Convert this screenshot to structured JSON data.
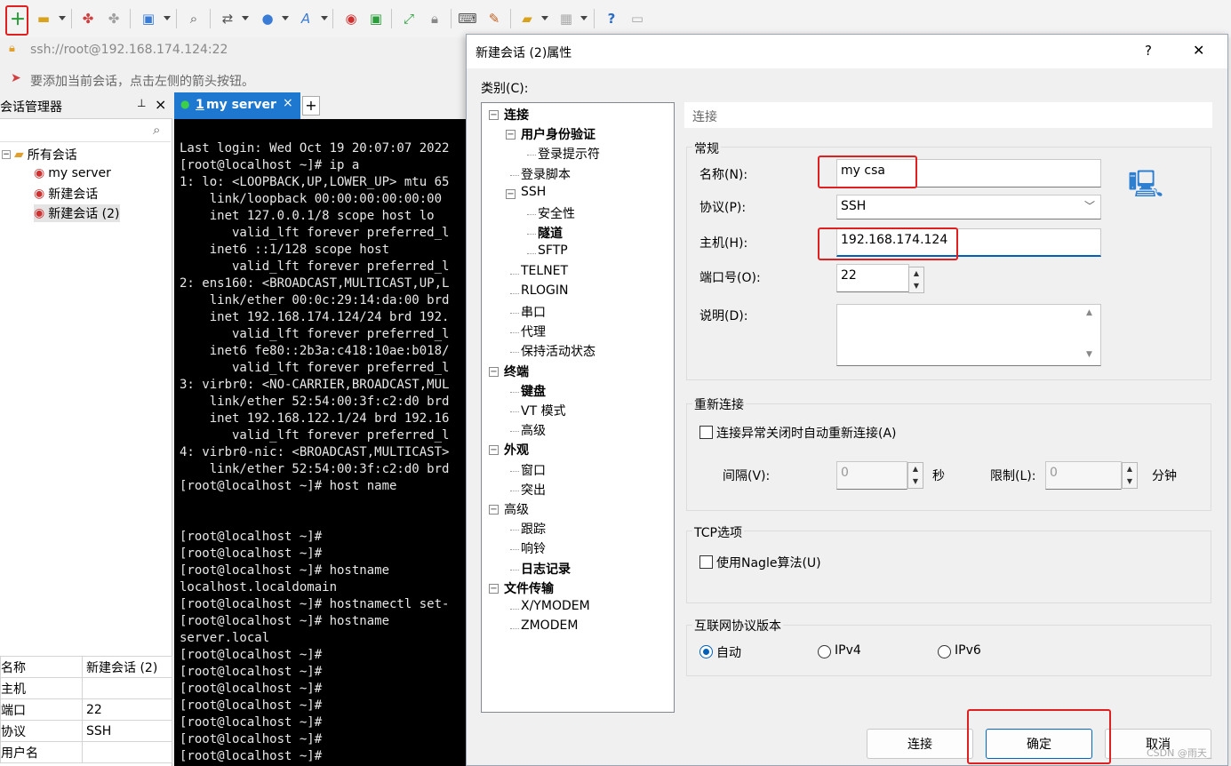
{
  "toolbar": {
    "address": "ssh://root@192.168.174.124:22",
    "hint": "要添加当前会话，点击左侧的箭头按钮。"
  },
  "session_manager": {
    "title": "会话管理器",
    "pin": "📌",
    "close": "×",
    "root": "所有会话",
    "items": [
      "my server",
      "新建会话",
      "新建会话 (2)"
    ],
    "props": [
      {
        "key": "名称",
        "value": "新建会话 (2)"
      },
      {
        "key": "主机",
        "value": ""
      },
      {
        "key": "端口",
        "value": "22"
      },
      {
        "key": "协议",
        "value": "SSH"
      },
      {
        "key": "用户名",
        "value": ""
      }
    ]
  },
  "terminal": {
    "tab_num": "1",
    "tab_label": "my server",
    "tab_close": "×",
    "add_tab": "+",
    "lines": [
      "Last login: Wed Oct 19 20:07:07 2022",
      "[root@localhost ~]# ip a",
      "1: lo: <LOOPBACK,UP,LOWER_UP> mtu 65",
      "    link/loopback 00:00:00:00:00:00",
      "    inet 127.0.0.1/8 scope host lo",
      "       valid_lft forever preferred_l",
      "    inet6 ::1/128 scope host",
      "       valid_lft forever preferred_l",
      "2: ens160: <BROADCAST,MULTICAST,UP,L",
      "    link/ether 00:0c:29:14:da:00 brd",
      "    inet 192.168.174.124/24 brd 192.",
      "       valid_lft forever preferred_l",
      "    inet6 fe80::2b3a:c418:10ae:b018/",
      "       valid_lft forever preferred_l",
      "3: virbr0: <NO-CARRIER,BROADCAST,MUL",
      "    link/ether 52:54:00:3f:c2:d0 brd",
      "    inet 192.168.122.1/24 brd 192.16",
      "       valid_lft forever preferred_l",
      "4: virbr0-nic: <BROADCAST,MULTICAST>",
      "    link/ether 52:54:00:3f:c2:d0 brd",
      "[root@localhost ~]# host name",
      "",
      "",
      "[root@localhost ~]#",
      "[root@localhost ~]#",
      "[root@localhost ~]# hostname",
      "localhost.localdomain",
      "[root@localhost ~]# hostnamectl set-",
      "[root@localhost ~]# hostname",
      "server.local",
      "[root@localhost ~]#",
      "[root@localhost ~]#",
      "[root@localhost ~]#",
      "[root@localhost ~]#",
      "[root@localhost ~]#",
      "[root@localhost ~]#",
      "[root@localhost ~]#"
    ]
  },
  "dialog": {
    "title": "新建会话 (2)属性",
    "help": "?",
    "close": "✕",
    "category_label": "类别(C):",
    "categories": [
      {
        "label": "连接",
        "bold": true
      },
      {
        "label": "用户身份验证",
        "bold": true
      },
      {
        "label": "登录提示符",
        "bold": false
      },
      {
        "label": "登录脚本",
        "bold": false
      },
      {
        "label": "SSH",
        "bold": false
      },
      {
        "label": "安全性",
        "bold": false
      },
      {
        "label": "隧道",
        "bold": true
      },
      {
        "label": "SFTP",
        "bold": false
      },
      {
        "label": "TELNET",
        "bold": false
      },
      {
        "label": "RLOGIN",
        "bold": false
      },
      {
        "label": "串口",
        "bold": false
      },
      {
        "label": "代理",
        "bold": false
      },
      {
        "label": "保持活动状态",
        "bold": false
      },
      {
        "label": "终端",
        "bold": true
      },
      {
        "label": "键盘",
        "bold": true
      },
      {
        "label": "VT 模式",
        "bold": false
      },
      {
        "label": "高级",
        "bold": false
      },
      {
        "label": "外观",
        "bold": true
      },
      {
        "label": "窗口",
        "bold": false
      },
      {
        "label": "突出",
        "bold": false
      },
      {
        "label": "高级",
        "bold": false
      },
      {
        "label": "跟踪",
        "bold": false
      },
      {
        "label": "响铃",
        "bold": false
      },
      {
        "label": "日志记录",
        "bold": true
      },
      {
        "label": "文件传输",
        "bold": true
      },
      {
        "label": "X/YMODEM",
        "bold": false
      },
      {
        "label": "ZMODEM",
        "bold": false
      }
    ],
    "section_title": "连接",
    "general": {
      "title": "常规",
      "name_label": "名称(N):",
      "name_value": "my csa",
      "protocol_label": "协议(P):",
      "protocol_value": "SSH",
      "host_label": "主机(H):",
      "host_value": "192.168.174.124",
      "port_label": "端口号(O):",
      "port_value": "22",
      "desc_label": "说明(D):",
      "desc_value": ""
    },
    "reconnect": {
      "title": "重新连接",
      "checkbox_label": "连接异常关闭时自动重新连接(A)",
      "interval_label": "间隔(V):",
      "interval_value": "0",
      "interval_unit": "秒",
      "limit_label": "限制(L):",
      "limit_value": "0",
      "limit_unit": "分钟"
    },
    "tcp": {
      "title": "TCP选项",
      "nagle_label": "使用Nagle算法(U)"
    },
    "ipver": {
      "title": "互联网协议版本",
      "options": [
        "自动",
        "IPv4",
        "IPv6"
      ],
      "selected": "自动"
    },
    "buttons": {
      "connect": "连接",
      "ok": "确定",
      "cancel": "取消"
    }
  },
  "watermark": "CSDN @雨天_"
}
